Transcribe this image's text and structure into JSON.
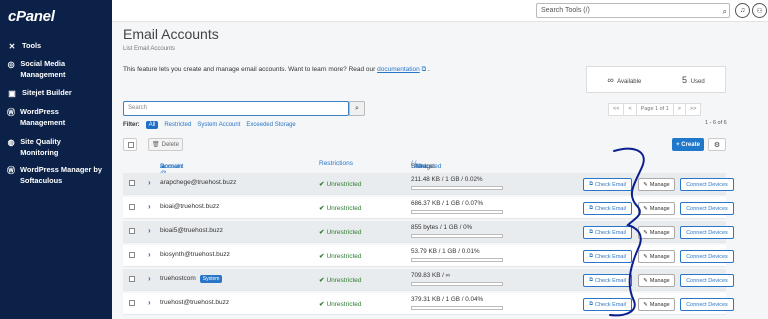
{
  "brand": {
    "logo_text": "cPanel"
  },
  "sidebar": {
    "items": [
      {
        "label": "Tools",
        "icon": "tools-icon"
      },
      {
        "label": "Social Media Management",
        "icon": "social-media-icon"
      },
      {
        "label": "Sitejet Builder",
        "icon": "sitejet-icon"
      },
      {
        "label": "WordPress Management",
        "icon": "wordpress-icon"
      },
      {
        "label": "Site Quality Monitoring",
        "icon": "site-quality-icon"
      },
      {
        "label": "WordPress Manager by Softaculous",
        "icon": "wordpress-icon"
      }
    ]
  },
  "topbar": {
    "search_placeholder": "Search Tools (/)"
  },
  "page": {
    "title": "Email Accounts",
    "breadcrumb": "List Email Accounts",
    "intro_text": "This feature lets you create and manage email accounts. Want to learn more? Read our",
    "intro_link": "documentation",
    "intro_end": "."
  },
  "stats": {
    "available_symbol": "∞",
    "available_label": "Available",
    "used_count": "5",
    "used_label": "Used"
  },
  "search": {
    "placeholder": "Search"
  },
  "pager": {
    "first": "<<",
    "prev": "<",
    "page_label": "Page 1 of 1",
    "next": ">",
    "last": ">>",
    "range": "1 - 6 of 6"
  },
  "filter": {
    "label": "Filter:",
    "options": [
      "All",
      "Restricted",
      "System Account",
      "Exceeded Storage"
    ],
    "active": "All"
  },
  "toolbar": {
    "delete_label": "Delete",
    "create_label": "+ Create"
  },
  "table": {
    "headers": {
      "account": "Account",
      "domain": "Domain",
      "restrictions": "Restrictions",
      "storage_prefix": "Storage:",
      "used": "Used",
      "allocated": "Allocated",
      "percent": "%"
    },
    "rows": [
      {
        "account": "arapchege@truehost.buzz",
        "system": false,
        "restriction": "Unrestricted",
        "storage": "211.48 KB / 1 GB / 0.02%",
        "percent": 0.02
      },
      {
        "account": "bioai@truehost.buzz",
        "system": false,
        "restriction": "Unrestricted",
        "storage": "686.37 KB / 1 GB / 0.07%",
        "percent": 0.07
      },
      {
        "account": "bioai5@truehost.buzz",
        "system": false,
        "restriction": "Unrestricted",
        "storage": "855 bytes / 1 GB / 0%",
        "percent": 0
      },
      {
        "account": "biosynth@truehost.buzz",
        "system": false,
        "restriction": "Unrestricted",
        "storage": "53.79 KB / 1 GB / 0.01%",
        "percent": 0.01
      },
      {
        "account": "truehostcom",
        "system": true,
        "system_label": "System",
        "restriction": "Unrestricted",
        "storage": "709.83 KB / ∞",
        "percent": 0
      },
      {
        "account": "truehost@truehost.buzz",
        "system": false,
        "restriction": "Unrestricted",
        "storage": "379.31 KB / 1 GB / 0.04%",
        "percent": 0.04
      }
    ],
    "actions": {
      "check_email": "Check Email",
      "manage": "Manage",
      "connect_devices": "Connect Devices"
    }
  },
  "colors": {
    "sidebar_bg": "#0b2147",
    "accent": "#1f78c9",
    "success": "#2e7d32",
    "annotation": "#0b1f8f"
  }
}
